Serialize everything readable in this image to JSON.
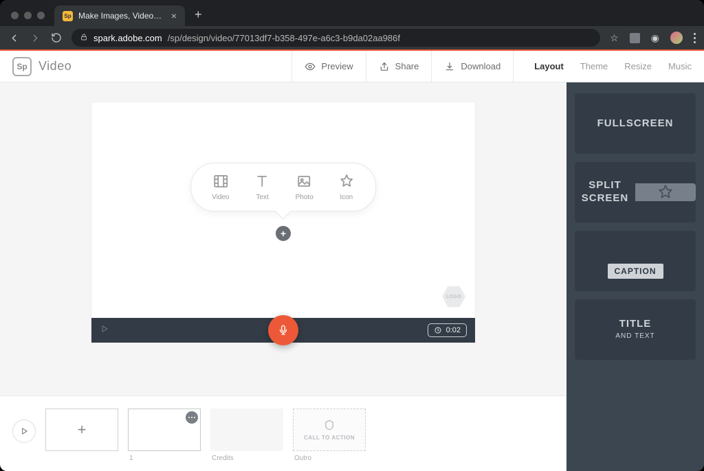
{
  "browser": {
    "tab_title": "Make Images, Videos and Web…",
    "url_host": "spark.adobe.com",
    "url_path": "/sp/design/video/77013df7-b358-497e-a6c3-b9da02aa986f"
  },
  "brand": {
    "logo_text": "Sp",
    "product": "Video"
  },
  "actions": {
    "preview": "Preview",
    "share": "Share",
    "download": "Download"
  },
  "tabs": {
    "layout": "Layout",
    "theme": "Theme",
    "resize": "Resize",
    "music": "Music"
  },
  "insert": {
    "video": "Video",
    "text": "Text",
    "photo": "Photo",
    "icon": "Icon"
  },
  "stage": {
    "logo_badge": "LOGO",
    "time": "0:02"
  },
  "filmstrip": {
    "slot1_label": "1",
    "credits_label": "Credits",
    "outro_label": "Outro",
    "cta_label": "CALL TO ACTION"
  },
  "layouts": {
    "fullscreen": "FULLSCREEN",
    "split1": "SPLIT",
    "split2": "SCREEN",
    "caption": "CAPTION",
    "title": "TITLE",
    "title_sub": "AND TEXT"
  }
}
